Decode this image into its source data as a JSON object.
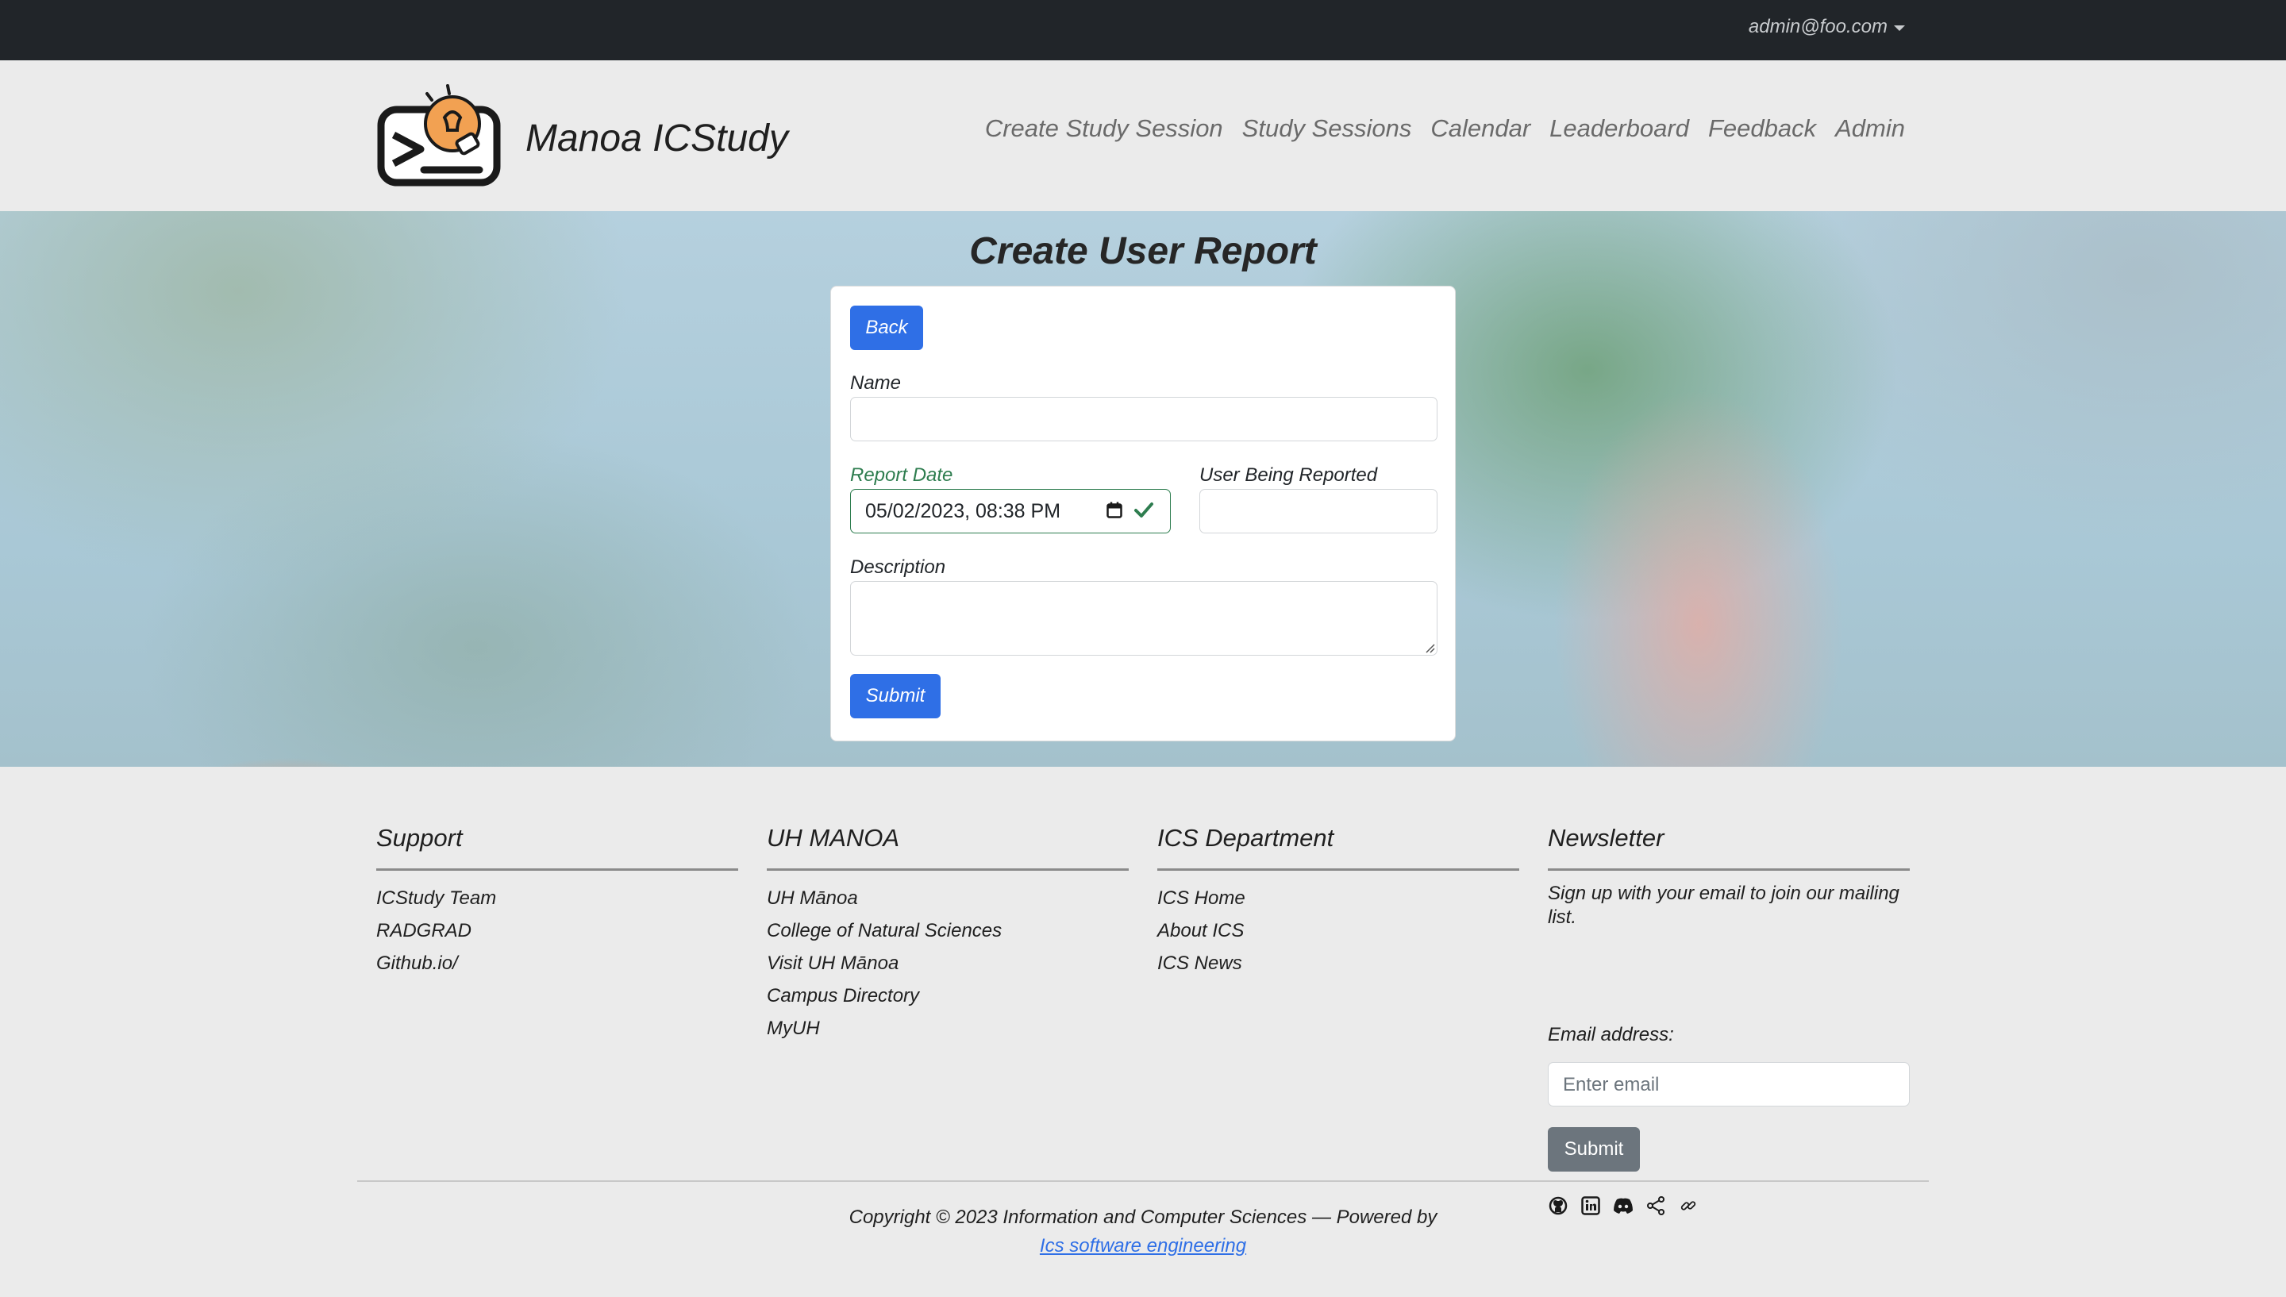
{
  "topbar": {
    "user_email": "admin@foo.com"
  },
  "header": {
    "brand_title": "Manoa ICStudy",
    "nav": [
      "Create Study Session",
      "Study Sessions",
      "Calendar",
      "Leaderboard",
      "Feedback",
      "Admin"
    ]
  },
  "form": {
    "title": "Create User Report",
    "back_label": "Back",
    "name_label": "Name",
    "name_value": "",
    "report_date_label": "Report Date",
    "report_date_value": "05/02/2023, 08:38 PM",
    "user_reported_label": "User Being Reported",
    "user_reported_value": "",
    "description_label": "Description",
    "description_value": "",
    "submit_label": "Submit"
  },
  "footer": {
    "support": {
      "heading": "Support",
      "links": [
        "ICStudy Team",
        "RADGRAD",
        "Github.io/"
      ]
    },
    "uh": {
      "heading": "UH MANOA",
      "links": [
        "UH Mānoa",
        "College of Natural Sciences",
        "Visit UH Mānoa",
        "Campus Directory",
        "MyUH"
      ]
    },
    "ics": {
      "heading": "ICS Department",
      "links": [
        "ICS Home",
        "About ICS",
        "ICS News"
      ]
    },
    "newsletter": {
      "heading": "Newsletter",
      "text": "Sign up with your email to join our mailing list.",
      "email_label": "Email address:",
      "email_placeholder": "Enter email",
      "submit_label": "Submit",
      "icons": [
        "github-icon",
        "linkedin-icon",
        "discord-icon",
        "share-icon",
        "link-icon"
      ]
    },
    "copyright": "Copyright © 2023 Information and Computer Sciences — Powered by",
    "powered_link": "Ics software engineering"
  },
  "colors": {
    "topbar": "#212529",
    "primary": "#2f6fe6",
    "secondary": "#6c757d",
    "valid": "#2e7d4f",
    "logo_orange": "#f2a152"
  }
}
